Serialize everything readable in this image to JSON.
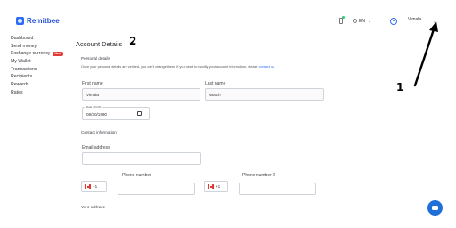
{
  "app": {
    "name": "Remitbee"
  },
  "header": {
    "language": "EN",
    "user_name": "Vimala"
  },
  "sidebar": {
    "items": [
      {
        "label": "Dashboard"
      },
      {
        "label": "Send money"
      },
      {
        "label": "Exchange currency",
        "badge": "New"
      },
      {
        "label": "My Wallet"
      },
      {
        "label": "Transactions"
      },
      {
        "label": "Recipients"
      },
      {
        "label": "Rewards"
      },
      {
        "label": "Rates"
      }
    ]
  },
  "main": {
    "title": "Account Details",
    "personal_section": "Personal details",
    "personal_note": "Once your personal details are verified, you can't change them. If you need to modify your account information, please",
    "contact_link": "contact us",
    "first_name_label": "First name",
    "first_name_value": "Vimala",
    "last_name_label": "Last name",
    "last_name_value": "Walch",
    "dob_label": "Date of birth",
    "dob_value": "08/30/1990",
    "contact_section": "Contact information",
    "email_label": "Email address",
    "email_value": "",
    "phone_label": "Phone number",
    "phone_code": "+1",
    "phone_value": "",
    "phone2_label": "Phone number 2",
    "phone2_code": "+1",
    "phone2_value": "",
    "address_section": "Your address"
  },
  "annotations": {
    "one": "1",
    "two": "2"
  },
  "colors": {
    "brand": "#1f4fd8",
    "accent": "#2d6df6",
    "badge": "#e53935",
    "chat": "#1f6fd8"
  },
  "icons": [
    "remitbee-logo-icon",
    "phone-icon",
    "globe-icon",
    "chevron-down-icon",
    "user-icon",
    "calendar-icon",
    "canada-flag-icon",
    "chat-icon"
  ]
}
